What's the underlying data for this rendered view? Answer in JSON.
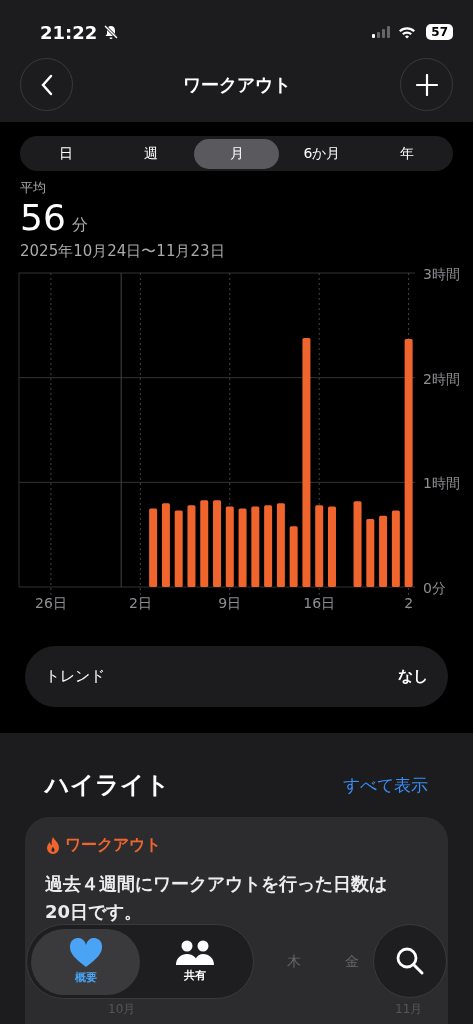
{
  "status_bar": {
    "time": "21:22",
    "battery": "57"
  },
  "nav": {
    "title": "ワークアウト"
  },
  "segments": [
    {
      "label": "日",
      "selected": false
    },
    {
      "label": "週",
      "selected": false
    },
    {
      "label": "月",
      "selected": true
    },
    {
      "label": "6か月",
      "selected": false
    },
    {
      "label": "年",
      "selected": false
    }
  ],
  "summary": {
    "label": "平均",
    "value": "56",
    "unit": "分",
    "range": "2025年10月24日〜11月23日"
  },
  "chart_data": {
    "type": "bar",
    "categories": [
      null,
      null,
      "26日",
      null,
      null,
      null,
      null,
      null,
      null,
      "2日",
      null,
      null,
      null,
      null,
      null,
      null,
      "9日",
      null,
      null,
      null,
      null,
      null,
      null,
      "16日",
      null,
      null,
      null,
      null,
      null,
      null,
      "2"
    ],
    "series": [
      {
        "color": "#f0652e",
        "values": [
          null,
          null,
          null,
          null,
          null,
          null,
          null,
          null,
          null,
          null,
          0.75,
          0.8,
          0.73,
          0.78,
          0.83,
          0.83,
          0.77,
          0.75,
          0.77,
          0.78,
          0.8,
          0.58,
          2.38,
          0.78,
          0.77,
          null,
          0.82,
          0.65,
          0.68,
          0.73,
          2.37
        ]
      }
    ],
    "ylim": [
      0,
      3
    ],
    "grid": true,
    "yticks": [
      {
        "value": 0,
        "label": "0分"
      },
      {
        "value": 1,
        "label": "1時間"
      },
      {
        "value": 2,
        "label": "2時間"
      },
      {
        "value": 3,
        "label": "3時間"
      }
    ]
  },
  "trend": {
    "label": "トレンド",
    "value": "なし"
  },
  "highlights": {
    "title": "ハイライト",
    "link": "すべて表示",
    "card": {
      "category": "ワークアウト",
      "text": "過去４週間にワークアウトを行った日数は20日です。",
      "days": [
        "木",
        "金"
      ],
      "months": [
        "10月",
        "11月"
      ]
    }
  },
  "tab_bar": {
    "tabs": [
      {
        "label": "概要",
        "selected": true,
        "kind": "heart"
      },
      {
        "label": "共有",
        "selected": false,
        "kind": "people"
      }
    ]
  }
}
